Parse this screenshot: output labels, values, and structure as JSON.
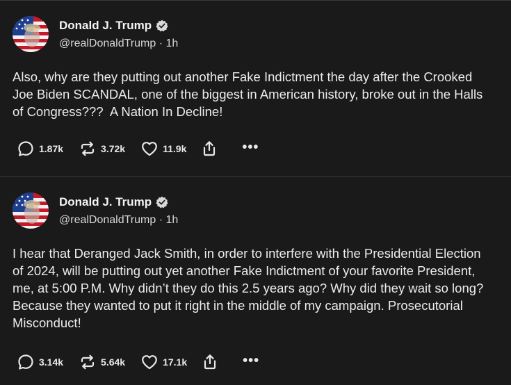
{
  "posts": [
    {
      "author": {
        "name": "Donald J. Trump",
        "handle": "@realDonaldTrump",
        "separator": "·",
        "time": "1h"
      },
      "text": "Also, why are they putting out another Fake Indictment the day after the Crooked Joe Biden SCANDAL, one of the biggest in American history, broke out in the Halls of Congress???  A Nation In Decline!",
      "replies": "1.87k",
      "reposts": "3.72k",
      "likes": "11.9k",
      "icons": [
        "reply-icon",
        "repost-icon",
        "heart-icon",
        "share-icon",
        "more-icon"
      ]
    },
    {
      "author": {
        "name": "Donald J. Trump",
        "handle": "@realDonaldTrump",
        "separator": "·",
        "time": "1h"
      },
      "text": "I hear that Deranged Jack Smith, in order to interfere with the Presidential Election of 2024, will be putting out yet another Fake Indictment of your favorite President, me, at 5:00 P.M. Why didn’t they do this 2.5 years ago? Why did they wait so long? Because they wanted to put it right in the middle of my campaign. Prosecutorial Misconduct!",
      "replies": "3.14k",
      "reposts": "5.64k",
      "likes": "17.1k",
      "icons": [
        "reply-icon",
        "repost-icon",
        "heart-icon",
        "share-icon",
        "more-icon"
      ]
    }
  ],
  "more_label": "•••",
  "colors": {
    "background": "#1a1a1a",
    "divider": "#3a3a3a",
    "text": "#ececec"
  }
}
